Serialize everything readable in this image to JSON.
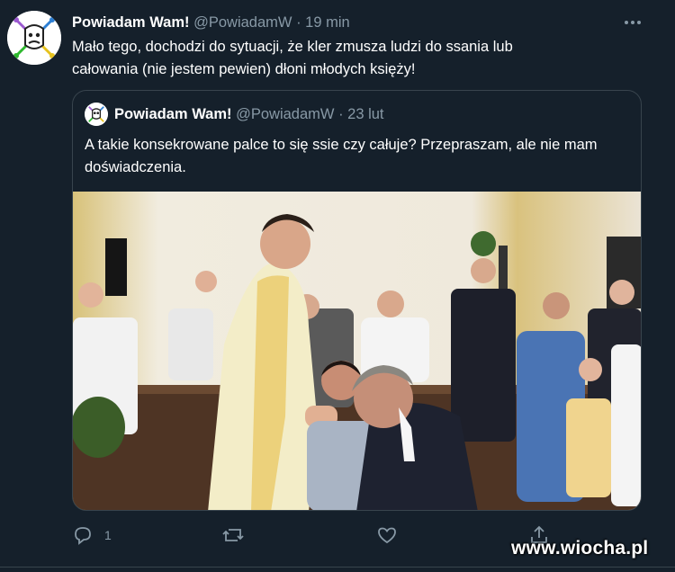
{
  "tweet": {
    "name": "Powiadam Wam!",
    "handle": "@PowiadamW",
    "separator": "·",
    "time": "19 min",
    "more_icon": "more-horizontal-icon",
    "text": "Mało tego, dochodzi do sytuacji, że kler zmusza ludzi do ssania lub całowania (nie jestem pewien) dłoni młodych księży!"
  },
  "quoted": {
    "name": "Powiadam Wam!",
    "handle": "@PowiadamW",
    "separator": "·",
    "time": "23 lut",
    "text": "A takie konsekrowane palce to się ssie czy całuje? Przepraszam, ale nie mam doświadczenia."
  },
  "actions": {
    "reply_icon": "reply-icon",
    "reply_count": "1",
    "retweet_icon": "retweet-icon",
    "like_icon": "like-icon",
    "share_icon": "share-icon"
  },
  "watermark": "www.wiocha.pl",
  "colors": {
    "background": "#15202b",
    "muted": "#8899a6",
    "border": "#38444d"
  }
}
